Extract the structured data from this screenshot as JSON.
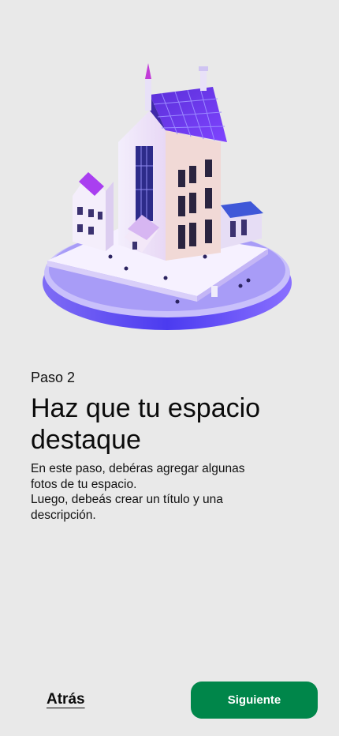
{
  "step": {
    "label": "Paso 2"
  },
  "heading": {
    "title_line1": "Haz que tu espacio",
    "title_line2": "destaque"
  },
  "description": {
    "line1": "En este paso, debéras agregar algunas",
    "line2": "fotos de tu espacio.",
    "line3": "Luego, debeás crear un título y una",
    "line4": "descripción."
  },
  "footer": {
    "back_label": "Atrás",
    "next_label": "Siguiente"
  },
  "colors": {
    "background": "#e9e9e9",
    "primary": "#00864a",
    "illustration_accent": "#6a3cff"
  },
  "illustration": {
    "icon": "isometric-building-illustration"
  }
}
